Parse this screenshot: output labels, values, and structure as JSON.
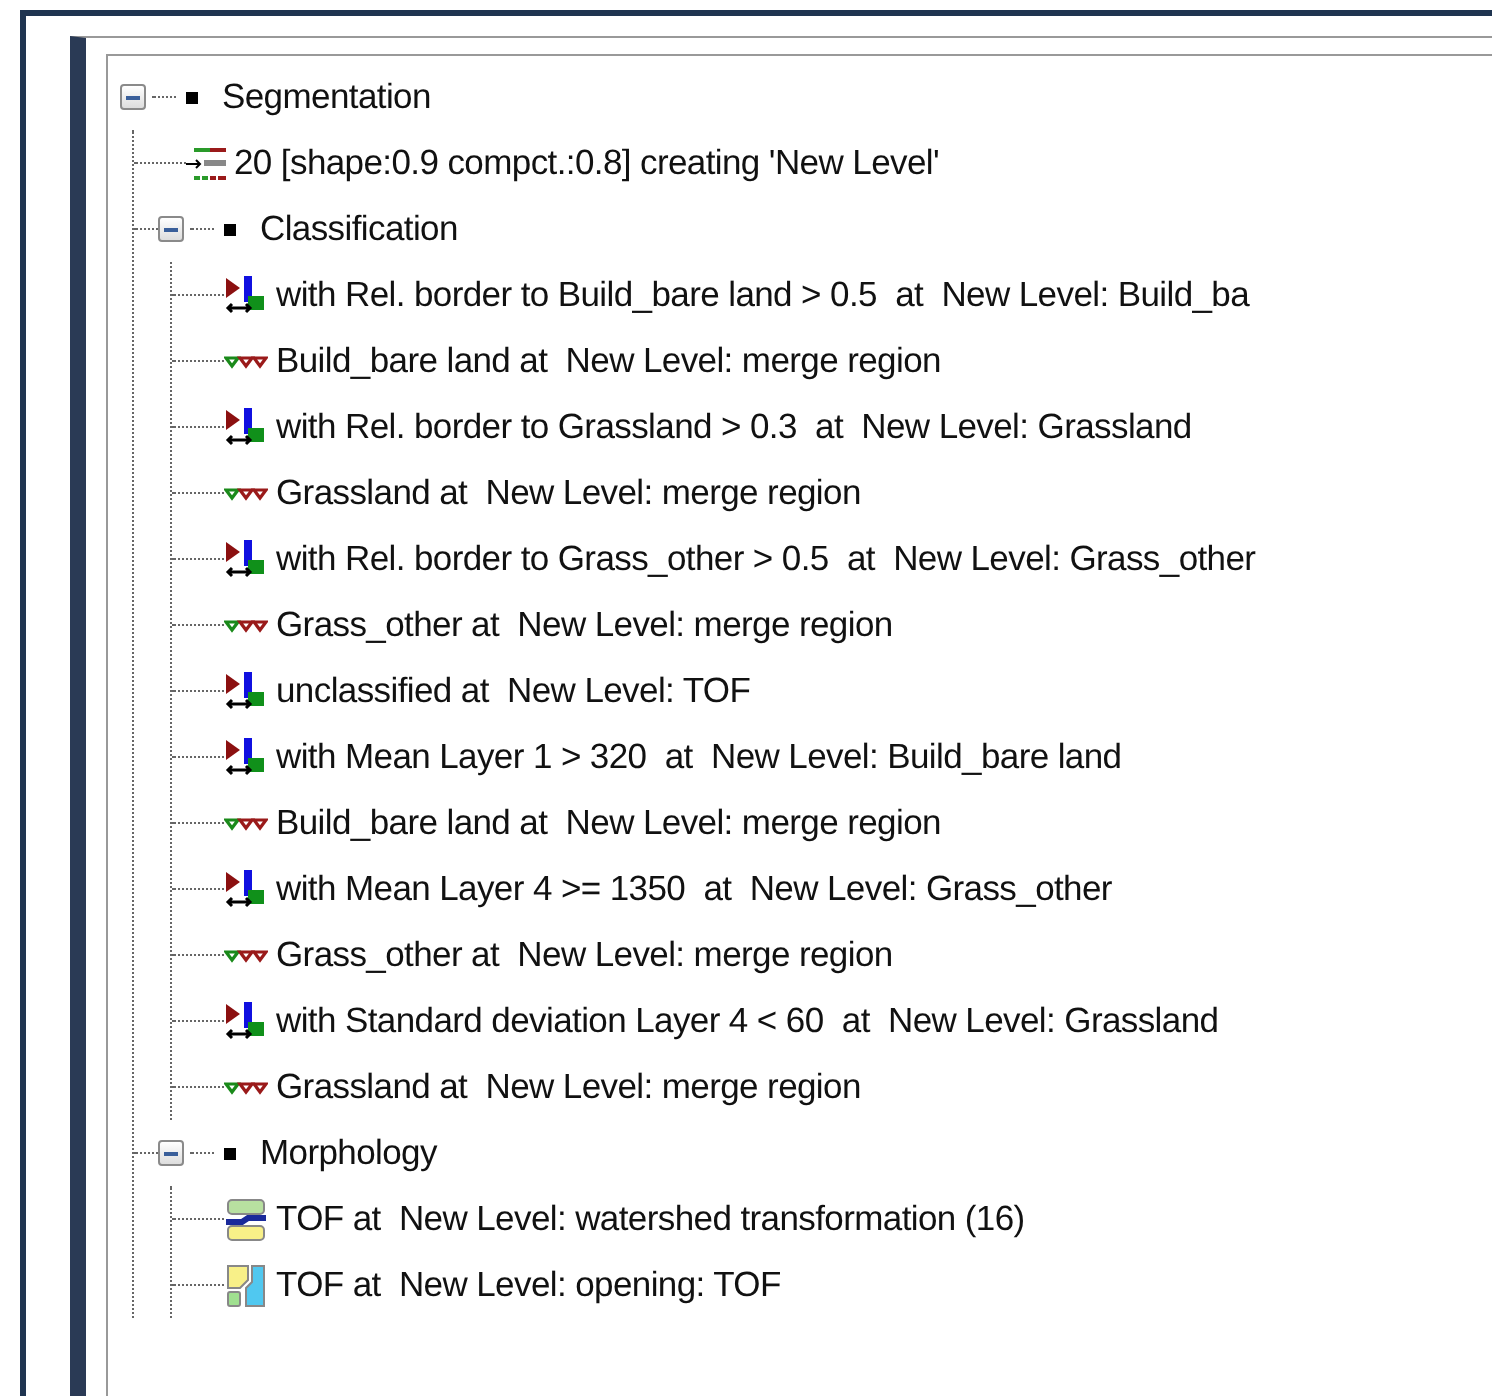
{
  "tree": [
    {
      "kind": "group",
      "label": "Segmentation",
      "expanded": true,
      "children": [
        {
          "kind": "segmentation",
          "label": "20 [shape:0.9 compct.:0.8] creating 'New Level'"
        },
        {
          "kind": "group",
          "label": "Classification",
          "expanded": true,
          "children": [
            {
              "kind": "classify",
              "label": "with Rel. border to Build_bare land > 0.5  at  New Level: Build_ba"
            },
            {
              "kind": "merge",
              "label": "Build_bare land at  New Level: merge region"
            },
            {
              "kind": "classify",
              "label": "with Rel. border to Grassland > 0.3  at  New Level: Grassland"
            },
            {
              "kind": "merge",
              "label": "Grassland at  New Level: merge region"
            },
            {
              "kind": "classify",
              "label": "with Rel. border to Grass_other > 0.5  at  New Level: Grass_other"
            },
            {
              "kind": "merge",
              "label": "Grass_other at  New Level: merge region"
            },
            {
              "kind": "classify",
              "label": "unclassified at  New Level: TOF"
            },
            {
              "kind": "classify",
              "label": "with Mean Layer 1 > 320  at  New Level: Build_bare land"
            },
            {
              "kind": "merge",
              "label": "Build_bare land at  New Level: merge region"
            },
            {
              "kind": "classify",
              "label": "with Mean Layer 4 >= 1350  at  New Level: Grass_other"
            },
            {
              "kind": "merge",
              "label": "Grass_other at  New Level: merge region"
            },
            {
              "kind": "classify",
              "label": "with Standard deviation Layer 4 < 60  at  New Level: Grassland"
            },
            {
              "kind": "merge",
              "label": "Grassland at  New Level: merge region"
            }
          ]
        },
        {
          "kind": "group",
          "label": "Morphology",
          "expanded": true,
          "children": [
            {
              "kind": "watershed",
              "label": "TOF at  New Level: watershed transformation (16)"
            },
            {
              "kind": "opening",
              "label": "TOF at  New Level: opening: TOF"
            }
          ]
        }
      ]
    }
  ]
}
